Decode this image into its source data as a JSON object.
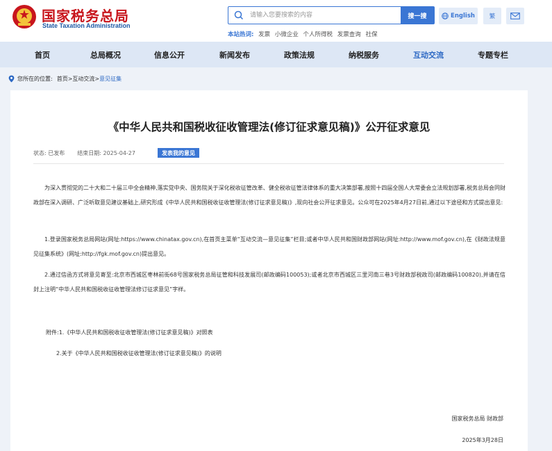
{
  "header": {
    "logo_cn": "国家税务总局",
    "logo_en": "State Taxation Administration",
    "search": {
      "placeholder": "请输入您要搜索的内容",
      "button": "搜一搜"
    },
    "hot": {
      "label": "本站热词:",
      "items": [
        "发票",
        "小微企业",
        "个人所得税",
        "发票查询",
        "社保"
      ]
    },
    "english": "English",
    "traditional": "繁"
  },
  "nav": [
    "首页",
    "总局概况",
    "信息公开",
    "新闻发布",
    "政策法规",
    "纳税服务",
    "互动交流",
    "专题专栏"
  ],
  "breadcrumb": {
    "prefix": "您所在的位置:",
    "home": "首页",
    "sep1": ">",
    "section": "互动交流",
    "sep2": ">",
    "current": "意见征集"
  },
  "article": {
    "title": "《中华人民共和国税收征收管理法(修订征求意见稿)》公开征求意见",
    "status": "状态: 已发布",
    "end_date": "结束日期: 2025-04-27",
    "opinion_button": "发表我的意见",
    "intro": "为深入贯彻党的二十大和二十届三中全会精神,落实党中央、国务院关于深化税收征管改革、健全税收征管法律体系的重大决策部署,按照十四届全国人大常委会立法规划部署,税务总局会同财政部在深入调研、广泛听取意见建议基础上,研究形成《中华人民共和国税收征收管理法(修订征求意见稿)》,现向社会公开征求意见。公众可在2025年4月27日前,通过以下途径和方式提出意见:",
    "way1": "1.登录国家税务总局网站(网址:https://www.chinatax.gov.cn),在首页主菜单“互动交流—意见征集”栏目;或者中华人民共和国财政部网站(网址:http://www.mof.gov.cn),在《财政法规意见征集系统》(网址:http://fgk.mof.gov.cn)提出意见。",
    "way2": "2.通过信函方式将意见寄至:北京市西城区枣林前街68号国家税务总局征管和科技发展司(邮政编码100053);或者北京市西城区三里河南三巷3号财政部税政司(邮政编码100820),并请在信封上注明“中华人民共和国税收征收管理法修订征求意见”字样。",
    "attachment1": "附件:1.《中华人民共和国税收征收管理法(修订征求意见稿)》对照表",
    "attachment2": "2.关于《中华人民共和国税收征收管理法(修订征求意见稿)》的说明",
    "signers": "国家税务总局 财政部",
    "date": "2025年3月28日"
  },
  "colors": {
    "brand_red": "#c8161d",
    "accent_blue": "#3a76d4",
    "nav_bg": "#dde7f5",
    "page_bg": "#eef2f8"
  }
}
